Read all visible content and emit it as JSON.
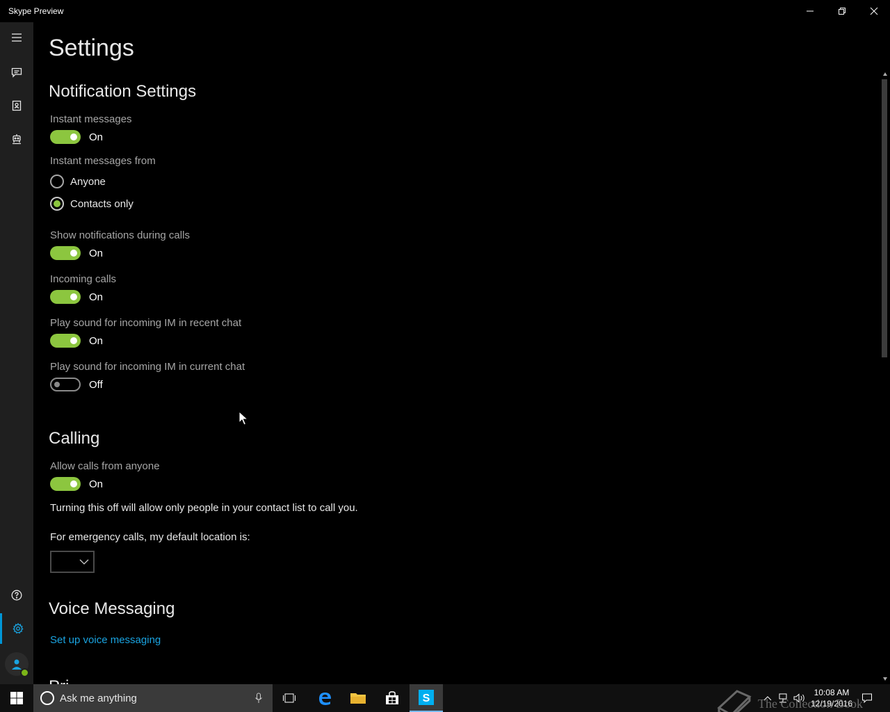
{
  "window": {
    "title": "Skype Preview"
  },
  "rail": {
    "items": [
      {
        "icon": "hamburger-menu-icon"
      },
      {
        "icon": "chat-icon"
      },
      {
        "icon": "contacts-icon"
      },
      {
        "icon": "bot-icon"
      },
      {
        "icon": "help-icon"
      },
      {
        "icon": "gear-icon",
        "active": true
      }
    ],
    "accent": "#0096d6"
  },
  "page": {
    "title": "Settings"
  },
  "notifications": {
    "heading": "Notification Settings",
    "instant_messages": {
      "label": "Instant messages",
      "state": "On",
      "on": true
    },
    "instant_messages_from": {
      "label": "Instant messages from",
      "options": [
        {
          "label": "Anyone",
          "checked": false
        },
        {
          "label": "Contacts only",
          "checked": true
        }
      ]
    },
    "during_calls": {
      "label": "Show notifications during calls",
      "state": "On",
      "on": true
    },
    "incoming_calls": {
      "label": "Incoming calls",
      "state": "On",
      "on": true
    },
    "sound_recent": {
      "label": "Play sound for incoming IM in recent chat",
      "state": "On",
      "on": true
    },
    "sound_current": {
      "label": "Play sound for incoming IM in current chat",
      "state": "Off",
      "on": false
    }
  },
  "calling": {
    "heading": "Calling",
    "allow_anyone": {
      "label": "Allow calls from anyone",
      "state": "On",
      "on": true
    },
    "note": "Turning this off will allow only people in your contact list to call you.",
    "emergency_label": "For emergency calls, my default location is:",
    "emergency_value": ""
  },
  "voice_messaging": {
    "heading": "Voice Messaging",
    "setup_link": "Set up voice messaging"
  },
  "next_section_partial": "Pri",
  "taskbar": {
    "search_placeholder": "Ask me anything",
    "time": "10:08 AM",
    "date": "12/19/2016",
    "watermark": "The Collection Book"
  },
  "colors": {
    "toggle_on": "#8cc63f",
    "link": "#1aa3e0"
  }
}
